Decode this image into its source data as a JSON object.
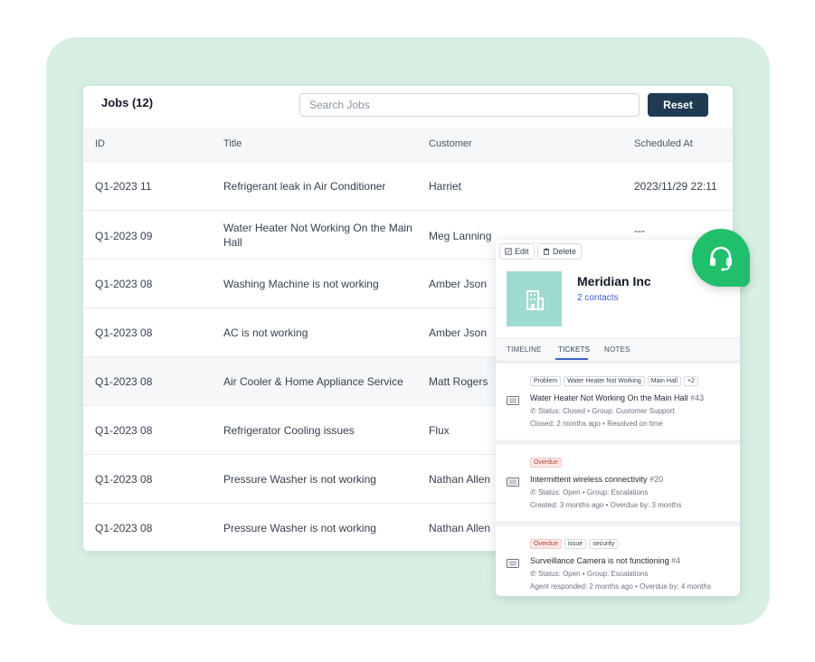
{
  "jobs": {
    "title": "Jobs (12)",
    "search_placeholder": "Search Jobs",
    "reset_label": "Reset",
    "columns": [
      "ID",
      "Title",
      "Customer",
      "Scheduled At"
    ],
    "rows": [
      {
        "id": "Q1-2023 11",
        "title": "Refrigerant leak in Air Conditioner",
        "customer": "Harriet",
        "scheduled": "2023/11/29 22:11"
      },
      {
        "id": "Q1-2023 09",
        "title": "Water Heater Not Working On the Main Hall",
        "customer": "Meg Lanning",
        "scheduled": "---"
      },
      {
        "id": "Q1-2023 08",
        "title": "Washing Machine is not working",
        "customer": "Amber Json",
        "scheduled": ""
      },
      {
        "id": "Q1-2023 08",
        "title": "AC is not working",
        "customer": "Amber Json",
        "scheduled": ""
      },
      {
        "id": "Q1-2023 08",
        "title": "Air Cooler & Home Appliance Service",
        "customer": "Matt Rogers",
        "scheduled": ""
      },
      {
        "id": "Q1-2023 08",
        "title": "Refrigerator Cooling issues",
        "customer": "Flux",
        "scheduled": ""
      },
      {
        "id": "Q1-2023 08",
        "title": "Pressure Washer is not working",
        "customer": "Nathan Allen",
        "scheduled": ""
      },
      {
        "id": "Q1-2023 08",
        "title": "Pressure Washer is not working",
        "customer": "Nathan Allen",
        "scheduled": ""
      }
    ]
  },
  "company": {
    "edit_label": "Edit",
    "delete_label": "Delete",
    "name": "Meridian Inc",
    "contacts": "2 contacts",
    "tabs": [
      "TIMELINE",
      "TICKETS",
      "NOTES"
    ],
    "active_tab": "TICKETS",
    "tickets": [
      {
        "tags": [
          "Problem",
          "Water Heater Not Working",
          "Main Hall",
          "+2"
        ],
        "title": "Water Heater Not Working On the Main Hall",
        "number": "#43",
        "status_line": "Status: Closed • Group: Customer Support",
        "time_line": "Closed: 2 months ago • Resolved on time"
      },
      {
        "tags": [
          "Overdue"
        ],
        "title": "Intermittent wireless connectivity",
        "number": "#20",
        "status_line": "Status: Open • Group: Escalations",
        "time_line": "Created: 3 months ago • Overdue by: 3 months"
      },
      {
        "tags": [
          "Overdue",
          "issue",
          "security"
        ],
        "title": "Surveillance Camera is not functioning",
        "number": "#4",
        "status_line": "Status: Open • Group: Escalations",
        "time_line": "Agent responded: 2 months ago • Overdue by: 4 months"
      }
    ]
  },
  "colors": {
    "background": "#d8efe3",
    "primary_button": "#1f3a52",
    "logo_tile": "#9fdbd1",
    "support_badge": "#1fbf6c",
    "overdue": "#c0392b"
  },
  "icons": {
    "support": "headset-icon",
    "edit": "edit-icon",
    "delete": "trash-icon",
    "company": "building-icon",
    "ticket": "ticket-icon",
    "phone": "phone-icon"
  }
}
